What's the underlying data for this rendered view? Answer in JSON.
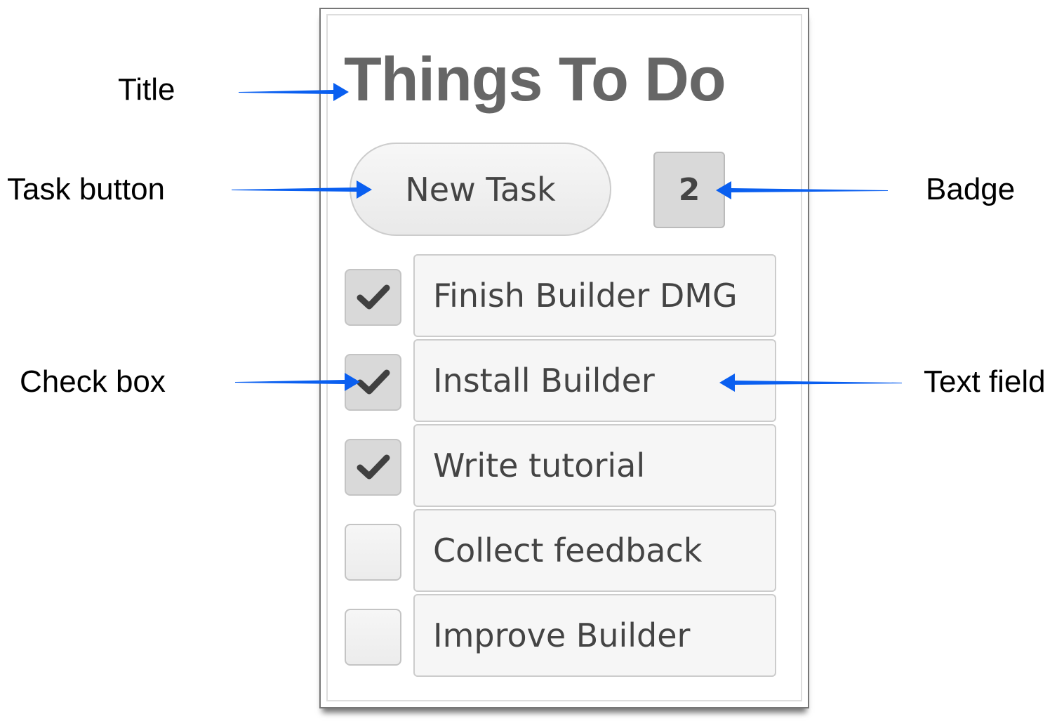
{
  "app": {
    "title": "Things To Do",
    "new_task_label": "New Task",
    "badge_count": "2",
    "tasks": [
      {
        "text": "Finish Builder DMG",
        "done": true
      },
      {
        "text": "Install Builder",
        "done": true
      },
      {
        "text": "Write tutorial",
        "done": true
      },
      {
        "text": "Collect feedback",
        "done": false
      },
      {
        "text": "Improve Builder",
        "done": false
      }
    ]
  },
  "annotations": {
    "title": "Title",
    "task_button": "Task button",
    "check_box": "Check box",
    "badge": "Badge",
    "text_field": "Text field"
  },
  "colors": {
    "arrow": "#0a5ff0",
    "title": "#666666"
  }
}
